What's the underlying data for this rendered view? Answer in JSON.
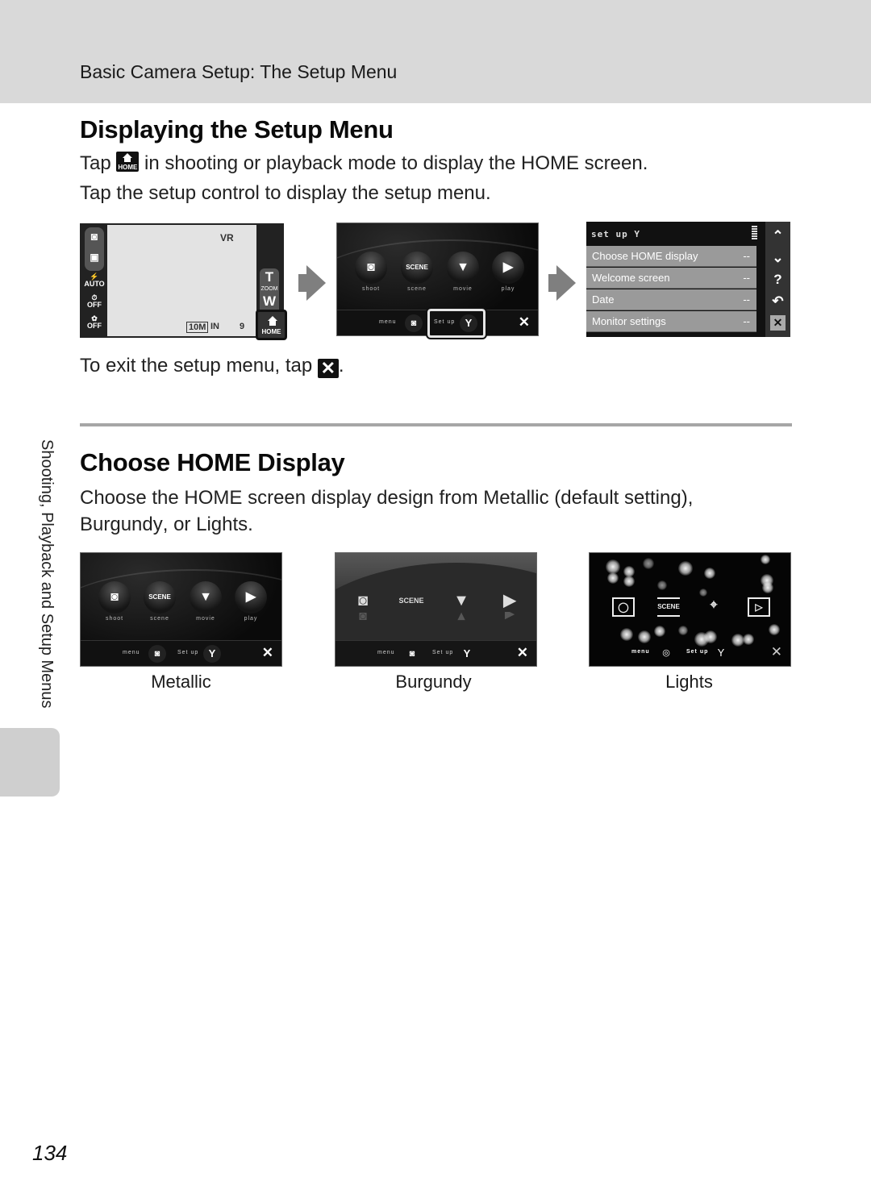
{
  "header": {
    "breadcrumb": "Basic Camera Setup: The Setup Menu"
  },
  "section1": {
    "title": "Displaying the Setup Menu",
    "line1_before": "Tap",
    "line1_icon": "home-icon",
    "line1_icon_text": "HOME",
    "line1_after": "in shooting or playback mode to display the HOME screen.",
    "line2": "Tap the setup control to display the setup menu.",
    "exit_before": "To exit the setup menu, tap",
    "exit_icon": "close-icon",
    "exit_icon_glyph": "✕",
    "exit_after": "."
  },
  "shooting_screen": {
    "vr": "VR",
    "flash": "AUTO",
    "self_timer": "OFF",
    "macro": "OFF",
    "zoom_t": "T",
    "zoom_label": "ZOOM",
    "zoom_w": "W",
    "image_size": "10M",
    "memory": "IN",
    "remaining": "9",
    "home_label": "HOME"
  },
  "home_screen": {
    "icons": [
      {
        "name": "shoot",
        "label": "shoot",
        "glyph": "◙"
      },
      {
        "name": "scene",
        "label": "scene",
        "glyph": "SCENE"
      },
      {
        "name": "movie",
        "label": "movie",
        "glyph": "▼"
      },
      {
        "name": "play",
        "label": "play",
        "glyph": "▶"
      }
    ],
    "menu_label": "menu",
    "setup_label": "Set up",
    "setup_glyph": "Y",
    "menu_glyph": "◙",
    "close_glyph": "✕"
  },
  "setup_menu": {
    "title": "set up",
    "title_glyph": "Y",
    "items": [
      {
        "label": "Choose HOME display",
        "value": "--"
      },
      {
        "label": "Welcome screen",
        "value": "--"
      },
      {
        "label": "Date",
        "value": "--"
      },
      {
        "label": "Monitor settings",
        "value": "--"
      }
    ],
    "side_buttons": {
      "up": "⌃",
      "down": "⌄",
      "help": "?",
      "back": "↶",
      "close": "✕"
    }
  },
  "section2": {
    "title": "Choose HOME Display",
    "text_before": "Choose the HOME screen display design from",
    "opt1": "Metallic",
    "text_mid": "(default setting),",
    "opt2": "Burgundy",
    "text_or": ", or",
    "opt3": "Lights",
    "text_end": "."
  },
  "themes": [
    {
      "name": "Metallic"
    },
    {
      "name": "Burgundy"
    },
    {
      "name": "Lights"
    }
  ],
  "side_tab": {
    "label": "Shooting, Playback and Setup Menus"
  },
  "page_number": "134"
}
